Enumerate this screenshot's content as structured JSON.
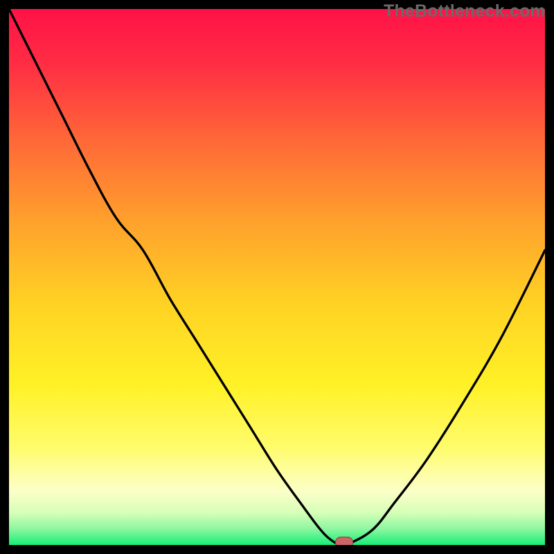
{
  "watermark": {
    "text": "TheBottleneck.com"
  },
  "colors": {
    "black": "#000000",
    "gradient_top": "#ff1247",
    "gradient_orange": "#ff8e2a",
    "gradient_yellow": "#ffe924",
    "gradient_pale": "#fdffbb",
    "gradient_green": "#19f07a",
    "curve_stroke": "#000000",
    "marker_fill": "#cc6666",
    "marker_stroke": "#8a3c3c"
  },
  "chart_data": {
    "type": "line",
    "title": "",
    "xlabel": "",
    "ylabel": "",
    "x": [
      0.0,
      0.05,
      0.1,
      0.15,
      0.2,
      0.25,
      0.3,
      0.35,
      0.4,
      0.45,
      0.5,
      0.55,
      0.58,
      0.6,
      0.62,
      0.64,
      0.68,
      0.72,
      0.78,
      0.85,
      0.92,
      1.0
    ],
    "values": [
      1.0,
      0.9,
      0.8,
      0.7,
      0.61,
      0.55,
      0.46,
      0.38,
      0.3,
      0.22,
      0.14,
      0.07,
      0.03,
      0.01,
      0.0,
      0.005,
      0.03,
      0.08,
      0.16,
      0.27,
      0.39,
      0.55
    ],
    "xlim": [
      0,
      1
    ],
    "ylim": [
      0,
      1
    ],
    "marker": {
      "x": 0.625,
      "y": 0.0
    },
    "notes": "x and y are normalized fractions of the plot area; y=0 is bottom (green), y=1 is top (red). Curve shows a V-shaped dip with minimum near x≈0.62."
  }
}
